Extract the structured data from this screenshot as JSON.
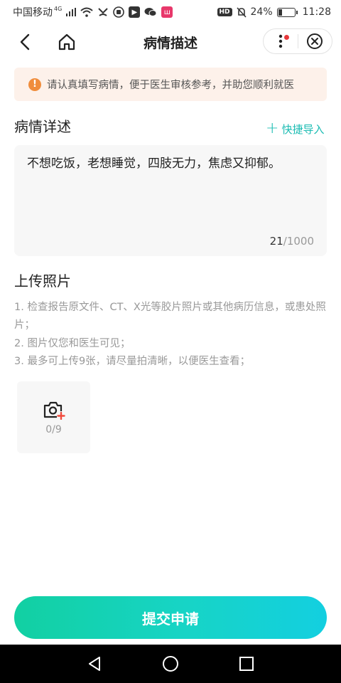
{
  "status_bar": {
    "carrier": "中国移动",
    "network": "4G",
    "battery_percent": "24%",
    "battery_level": 0.24,
    "time": "11:28",
    "hd_label": "HD"
  },
  "nav": {
    "title": "病情描述",
    "back_icon": "chevron-left-icon",
    "home_icon": "home-icon",
    "more_icon": "more-vertical-icon",
    "close_icon": "close-circle-icon"
  },
  "notice": {
    "icon": "!",
    "text": "请认真填写病情，便于医生审核参考，并助您顺利就医"
  },
  "description": {
    "title": "病情详述",
    "quick_import_label": "快捷导入",
    "value": "不想吃饭，老想睡觉，四肢无力，焦虑又抑郁。",
    "count_current": "21",
    "count_max": "/1000"
  },
  "upload": {
    "title": "上传照片",
    "tips": [
      "1. 检查报告原文件、CT、X光等胶片照片或其他病历信息，或患处照片；",
      "2. 图片仅您和医生可见；",
      "3. 最多可上传9张，请尽量拍清晰，以便医生查看；"
    ],
    "count_label": "0/9"
  },
  "submit": {
    "label": "提交申请"
  },
  "colors": {
    "accent": "#1bbcb3",
    "notice_bg": "#fdf1ea",
    "notice_icon": "#f08d3c",
    "submit_gradient_start": "#12d0a2",
    "submit_gradient_end": "#13cfe0"
  }
}
